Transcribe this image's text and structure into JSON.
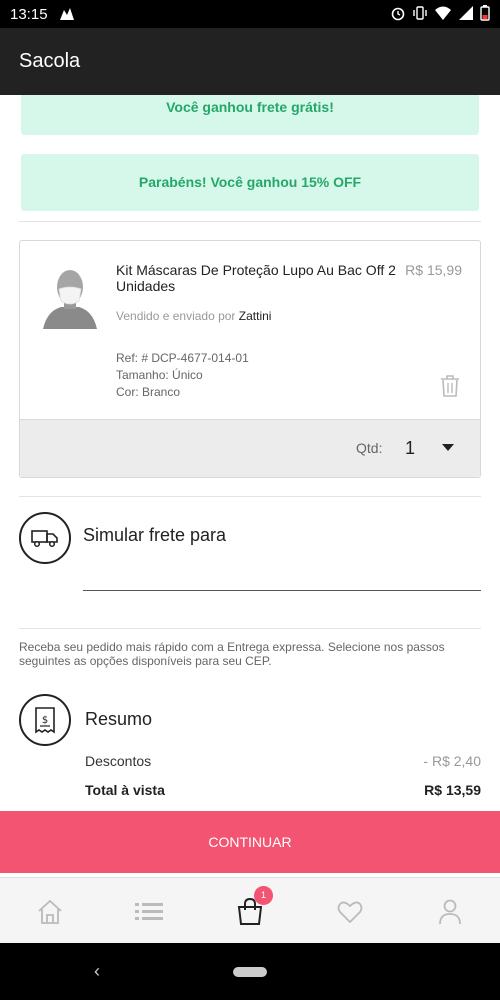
{
  "status_bar": {
    "time": "13:15"
  },
  "app_bar": {
    "title": "Sacola"
  },
  "banners": {
    "free_shipping": "Você ganhou frete grátis!",
    "discount": "Parabéns! Você ganhou 15% OFF"
  },
  "product": {
    "name": "Kit Máscaras De Proteção Lupo Au Bac Off 2 Unidades",
    "price": "R$ 15,99",
    "sold_by_label": "Vendido e enviado por",
    "seller": "Zattini",
    "ref": "Ref: # DCP-4677-014-01",
    "size": "Tamanho: Único",
    "color": "Cor: Branco",
    "qty_label": "Qtd:",
    "qty_value": "1"
  },
  "shipping": {
    "title": "Simular frete para",
    "cep_value": "",
    "express_note": "Receba seu pedido mais rápido com a Entrega expressa. Selecione nos passos seguintes as opções disponíveis para seu CEP."
  },
  "summary": {
    "title": "Resumo",
    "discount_label": "Descontos",
    "discount_value": "- R$ 2,40",
    "total_label": "Total à vista",
    "total_value": "R$ 13,59"
  },
  "continue_label": "CONTINUAR",
  "bottom_nav": {
    "cart_badge": "1",
    "items": [
      "home-icon",
      "list-icon",
      "shopping-bag-icon",
      "heart-icon",
      "user-icon"
    ]
  },
  "colors": {
    "accent": "#f25471",
    "banner_bg": "#d6f8ea",
    "banner_text": "#25a76a",
    "app_bar": "#222222"
  }
}
